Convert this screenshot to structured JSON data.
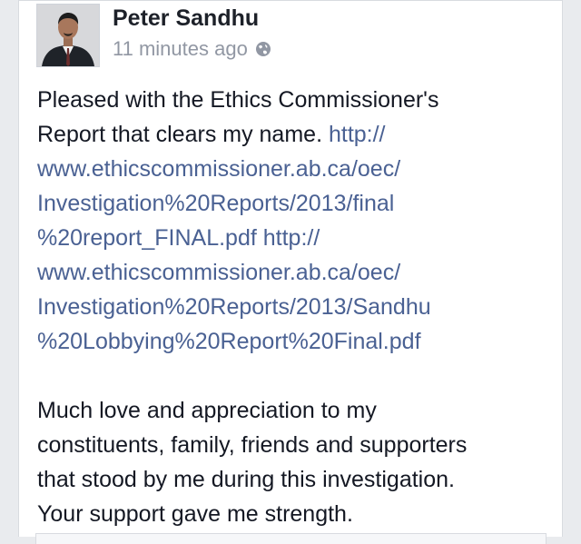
{
  "post": {
    "author": {
      "name": "Peter Sandhu",
      "avatar_icon": "profile-photo"
    },
    "meta": {
      "timestamp": "11 minutes ago",
      "privacy_icon": "globe-icon"
    },
    "body": {
      "lines": [
        {
          "type": "text",
          "text": "Pleased with the Ethics Commissioner's"
        },
        {
          "type": "mixed",
          "text": "Report that clears my name. ",
          "link": "http://"
        },
        {
          "type": "link",
          "text": "www.ethicscommissioner.ab.ca/oec/"
        },
        {
          "type": "link",
          "text": "Investigation%20Reports/2013/final"
        },
        {
          "type": "link",
          "text": "%20report_FINAL.pdf http://"
        },
        {
          "type": "link",
          "text": "www.ethicscommissioner.ab.ca/oec/"
        },
        {
          "type": "link",
          "text": "Investigation%20Reports/2013/Sandhu"
        },
        {
          "type": "link",
          "text": "%20Lobbying%20Report%20Final.pdf"
        },
        {
          "type": "blank",
          "text": ""
        },
        {
          "type": "text",
          "text": "Much love and appreciation to my"
        },
        {
          "type": "text",
          "text": "constituents, family, friends and supporters"
        },
        {
          "type": "text",
          "text": "that stood by me during this investigation."
        },
        {
          "type": "text",
          "text": "Your support gave me strength."
        }
      ]
    }
  },
  "colors": {
    "text": "#141823",
    "link": "#4a6193",
    "meta": "#9197a3",
    "background": "#e9ebee",
    "card": "#ffffff"
  }
}
